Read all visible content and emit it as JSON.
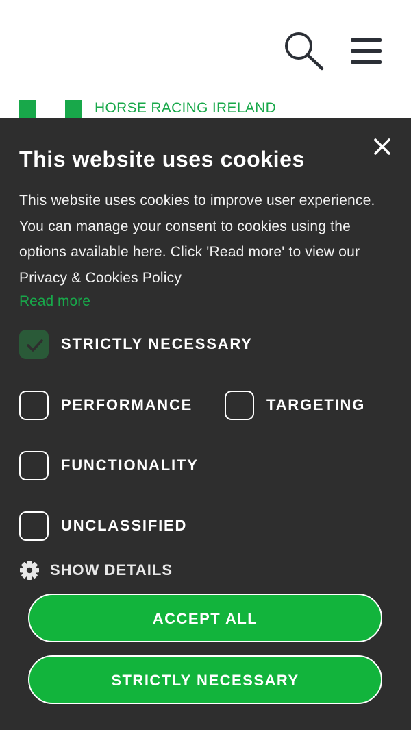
{
  "header": {
    "logo_text": "HORSE RACING IRELAND",
    "search_icon": "search-icon",
    "menu_icon": "hamburger-menu-icon"
  },
  "cookie_banner": {
    "title": "This website uses cookies",
    "description": "This website uses cookies to improve user experience. You can manage your consent to cookies using the options available here. Click 'Read more' to view our Privacy & Cookies Policy",
    "read_more_label": "Read more",
    "close_icon": "close-icon",
    "options": [
      {
        "label": "STRICTLY NECESSARY",
        "checked": true
      },
      {
        "label": "PERFORMANCE",
        "checked": false
      },
      {
        "label": "TARGETING",
        "checked": false
      },
      {
        "label": "FUNCTIONALITY",
        "checked": false
      },
      {
        "label": "UNCLASSIFIED",
        "checked": false
      }
    ],
    "show_details_label": "SHOW DETAILS",
    "show_details_icon": "gear-icon",
    "accept_all_label": "ACCEPT ALL",
    "strictly_necessary_button_label": "STRICTLY NECESSARY"
  },
  "colors": {
    "brand_green": "#18a84a",
    "button_green": "#12b43c",
    "panel_background": "#2e2e2e",
    "checked_checkbox": "#2a5a38"
  }
}
